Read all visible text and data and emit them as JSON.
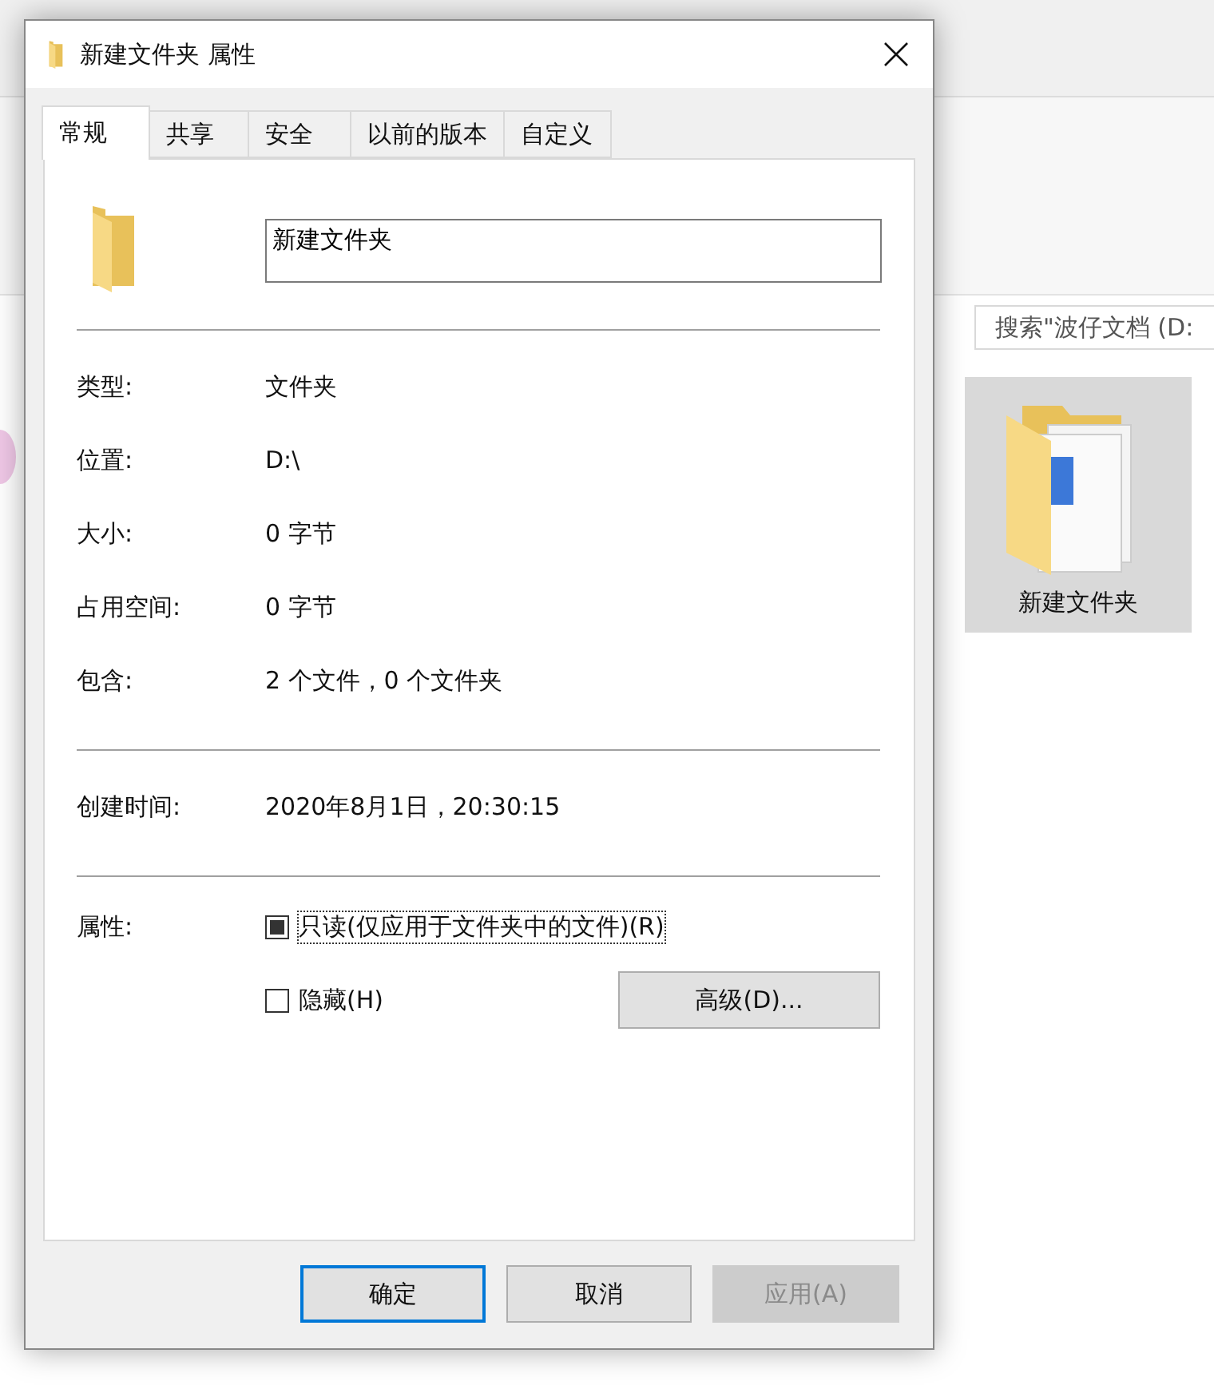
{
  "explorer": {
    "search": {
      "placeholder": "搜索\"波仔文档 (D:"
    },
    "items": [
      {
        "label": "新建文件夹",
        "selected": true
      }
    ]
  },
  "dialog": {
    "title": "新建文件夹 属性",
    "tabs": [
      {
        "label": "常规",
        "selected": true
      },
      {
        "label": "共享",
        "selected": false
      },
      {
        "label": "安全",
        "selected": false
      },
      {
        "label": "以前的版本",
        "selected": false
      },
      {
        "label": "自定义",
        "selected": false
      }
    ],
    "name_field": {
      "value": "新建文件夹"
    },
    "groups": [
      [
        {
          "label": "类型:",
          "value": "文件夹"
        },
        {
          "label": "位置:",
          "value": "D:\\"
        },
        {
          "label": "大小:",
          "value": "0 字节"
        },
        {
          "label": "占用空间:",
          "value": "0 字节"
        },
        {
          "label": "包含:",
          "value": "2 个文件，0 个文件夹"
        }
      ],
      [
        {
          "label": "创建时间:",
          "value": "2020年8月1日，20:30:15"
        }
      ]
    ],
    "attributes": {
      "label": "属性:",
      "checkboxes": [
        {
          "label": "只读(仅应用于文件夹中的文件)(R)",
          "checked": false,
          "mixed": true,
          "focused": true
        },
        {
          "label": "隐藏(H)",
          "checked": false,
          "mixed": false,
          "focused": false
        }
      ],
      "advanced_button": "高级(D)..."
    },
    "buttons": [
      {
        "label": "确定",
        "default": true,
        "disabled": false
      },
      {
        "label": "取消",
        "default": false,
        "disabled": false
      },
      {
        "label": "应用(A)",
        "default": false,
        "disabled": true
      }
    ]
  }
}
